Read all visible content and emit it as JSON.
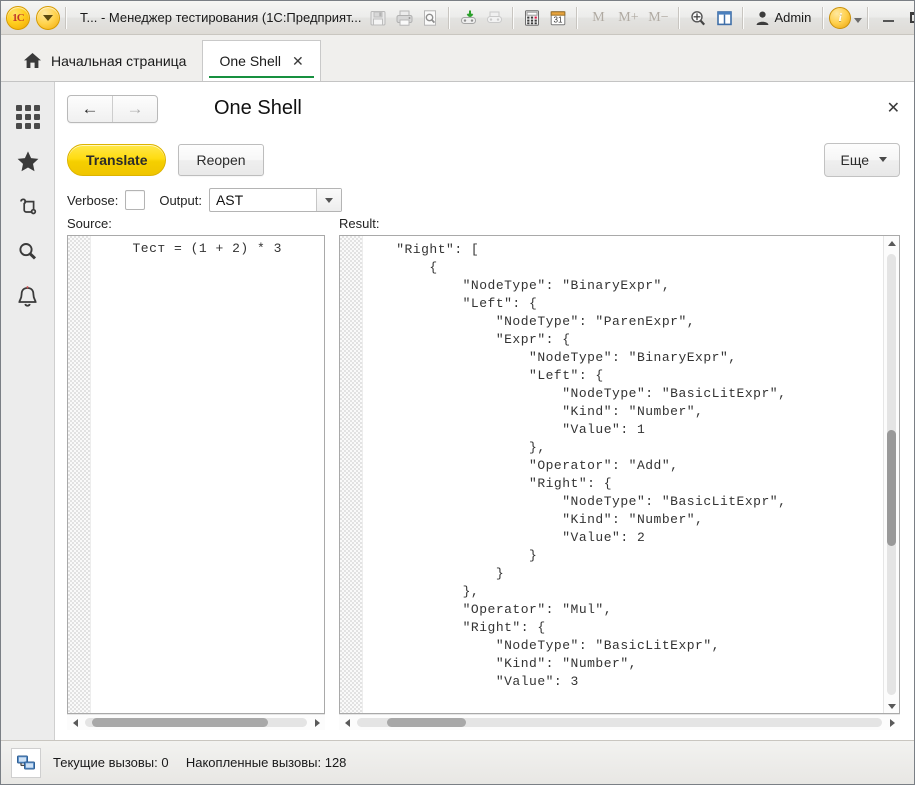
{
  "titlebar": {
    "window_title": "T... - Менеджер тестирования (1С:Предприят...",
    "logo_text": "1С",
    "memory_buttons": [
      "M",
      "M+",
      "M−"
    ],
    "user_name": "Admin",
    "info_glyph": "i",
    "close_glyph": "✕",
    "icons": [
      "save-icon",
      "print-icon",
      "print-preview-icon",
      "link-active-icon",
      "link-disabled-icon",
      "calculator-icon",
      "calendar-icon",
      "zoom-icon",
      "panels-icon",
      "user-icon"
    ]
  },
  "tabs": {
    "items": [
      {
        "label": "Начальная страница",
        "icon": "home-icon",
        "active": false,
        "closable": false
      },
      {
        "label": "One Shell",
        "icon": "",
        "active": true,
        "closable": true,
        "close_glyph": "✕"
      }
    ],
    "active_underline_color": "#17903f"
  },
  "sidebar": {
    "items": [
      {
        "name": "apps-grid-icon",
        "label": "Все функции"
      },
      {
        "name": "star-icon",
        "label": "Избранное"
      },
      {
        "name": "history-icon",
        "label": "История"
      },
      {
        "name": "search-icon",
        "label": "Поиск"
      },
      {
        "name": "bell-icon",
        "label": "Оповещения"
      }
    ]
  },
  "form": {
    "title": "One Shell",
    "back_glyph": "←",
    "forward_glyph": "→",
    "close_glyph": "✕"
  },
  "commandbar": {
    "translate_label": "Translate",
    "reopen_label": "Reopen",
    "more_label": "Еще",
    "primary_color": "#ffdc12"
  },
  "options": {
    "verbose_label": "Verbose:",
    "verbose_checked": false,
    "output_label": "Output:",
    "output_value": "AST",
    "output_options": [
      "AST"
    ]
  },
  "source_pane": {
    "label": "Source:",
    "text": "     Тест = (1 + 2) * 3",
    "hscroll_thumb_left_pct": 2,
    "hscroll_thumb_width_pct": 12
  },
  "result_pane": {
    "label": "Result:",
    "text": "    \"Right\": [\n        {\n            \"NodeType\": \"BinaryExpr\",\n            \"Left\": {\n                \"NodeType\": \"ParenExpr\",\n                \"Expr\": {\n                    \"NodeType\": \"BinaryExpr\",\n                    \"Left\": {\n                        \"NodeType\": \"BasicLitExpr\",\n                        \"Kind\": \"Number\",\n                        \"Value\": 1\n                    },\n                    \"Operator\": \"Add\",\n                    \"Right\": {\n                        \"NodeType\": \"BasicLitExpr\",\n                        \"Kind\": \"Number\",\n                        \"Value\": 2\n                    }\n                }\n            },\n            \"Operator\": \"Mul\",\n            \"Right\": {\n                \"NodeType\": \"BasicLitExpr\",\n                \"Kind\": \"Number\",\n                \"Value\": 3",
    "vscroll_thumb_top_pct": 40,
    "vscroll_thumb_height_pct": 26,
    "hscroll_thumb_left_pct": 6,
    "hscroll_thumb_width_pct": 15
  },
  "statusbar": {
    "icon": "network-calls-icon",
    "current_calls_label": "Текущие вызовы:",
    "current_calls_value": "0",
    "total_calls_label": "Накопленные вызовы:",
    "total_calls_value": "128"
  }
}
